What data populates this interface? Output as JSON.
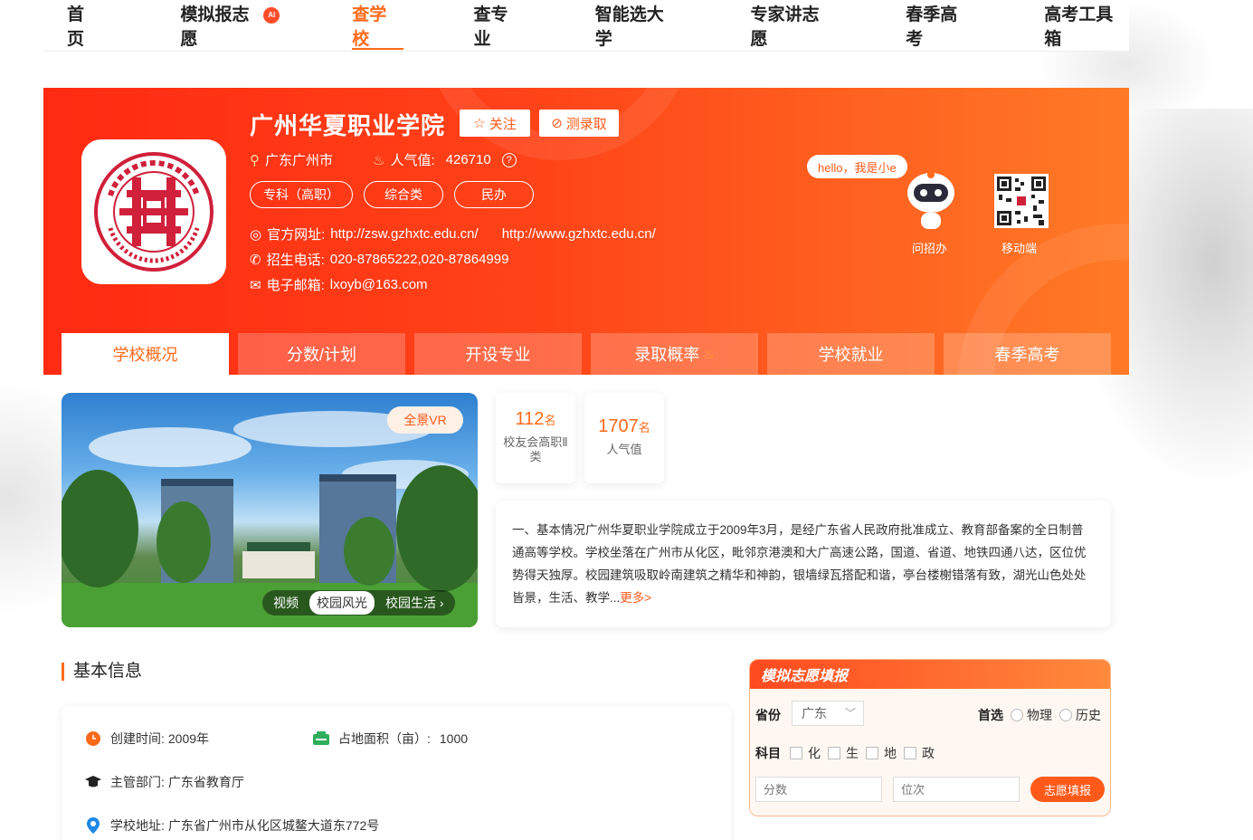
{
  "colors": {
    "accent": "#ff6a1a",
    "hero_start": "#ff2a12",
    "hero_end": "#ff7a26"
  },
  "nav": {
    "items": [
      {
        "label": "首页",
        "active": false
      },
      {
        "label": "模拟报志愿",
        "active": false,
        "badge": "AI"
      },
      {
        "label": "查学校",
        "active": true
      },
      {
        "label": "查专业",
        "active": false
      },
      {
        "label": "智能选大学",
        "active": false
      },
      {
        "label": "专家讲志愿",
        "active": false
      },
      {
        "label": "春季高考",
        "active": false
      },
      {
        "label": "高考工具箱",
        "active": false
      }
    ]
  },
  "school": {
    "name": "广州华夏职业学院",
    "follow_label": "关注",
    "predict_label": "测录取",
    "location": "广东广州市",
    "popularity_label": "人气值:",
    "popularity": "426710",
    "tags": [
      "专科（高职）",
      "综合类",
      "民办"
    ],
    "website_label": "官方网址:",
    "website_1": "http://zsw.gzhxtc.edu.cn/",
    "website_2": "http://www.gzhxtc.edu.cn/",
    "phone_label": "招生电话:",
    "phone": "020-87865222,020-87864999",
    "email_label": "电子邮箱:",
    "email": "lxoyb@163.com"
  },
  "assistant": {
    "bubble": "hello，我是小e",
    "ask_label": "问招办",
    "mobile_label": "移动端"
  },
  "tabs": [
    {
      "label": "学校概况",
      "active": true
    },
    {
      "label": "分数/计划",
      "active": false
    },
    {
      "label": "开设专业",
      "active": false
    },
    {
      "label": "录取概率",
      "active": false,
      "hot": true
    },
    {
      "label": "学校就业",
      "active": false
    },
    {
      "label": "春季高考",
      "active": false
    }
  ],
  "photo": {
    "vr_label": "全景VR",
    "tabs": [
      {
        "label": "视频",
        "active": false
      },
      {
        "label": "校园风光",
        "active": true
      },
      {
        "label": "校园生活 ›",
        "active": false
      }
    ]
  },
  "stats": [
    {
      "value": "112",
      "unit": "名",
      "label": "校友会高职Ⅱ类"
    },
    {
      "value": "1707",
      "unit": "名",
      "label": "人气值"
    }
  ],
  "intro": {
    "text": "一、基本情况广州华夏职业学院成立于2009年3月，是经广东省人民政府批准成立、教育部备案的全日制普通高等学校。学校坐落在广州市从化区，毗邻京港澳和大广高速公路，国道、省道、地铁四通八达，区位优势得天独厚。校园建筑吸取岭南建筑之精华和神韵，银墙绿瓦搭配和谐，亭台楼榭错落有致，湖光山色处处皆景，生活、教学...",
    "more": "更多>"
  },
  "basic_info": {
    "title": "基本信息",
    "founded_label": "创建时间:",
    "founded": "2009年",
    "area_label": "占地面积（亩）:",
    "area": "1000",
    "authority_label": "主管部门:",
    "authority": "广东省教育厅",
    "address_label": "学校地址:",
    "address": "广东省广州市从化区城鳌大道东772号"
  },
  "form": {
    "title": "模拟志愿填报",
    "province_label": "省份",
    "province_value": "广东",
    "first_choice_label": "首选",
    "first_options": [
      "物理",
      "历史"
    ],
    "subject_label": "科目",
    "subjects": [
      "化",
      "生",
      "地",
      "政"
    ],
    "score_placeholder": "分数",
    "rank_placeholder": "位次",
    "submit_label": "志愿填报"
  }
}
